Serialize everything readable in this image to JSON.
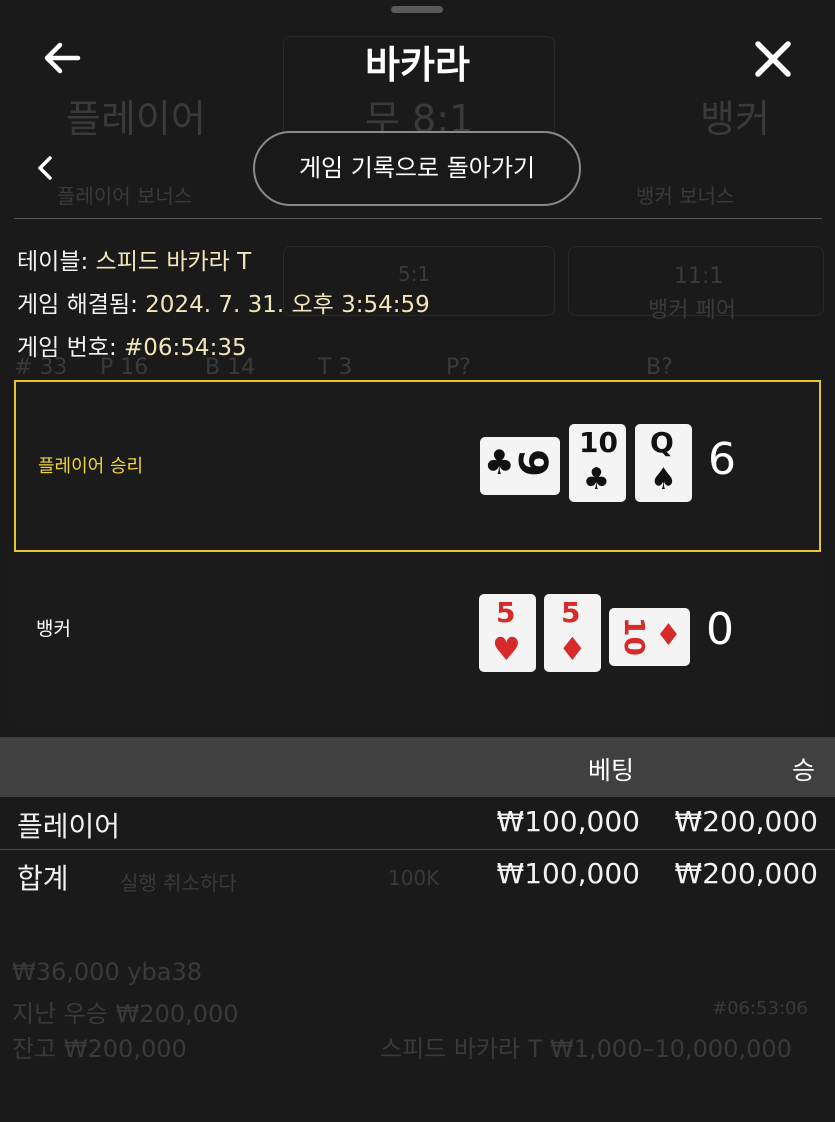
{
  "header": {
    "title": "바카라",
    "back_icon": "arrow-left-icon",
    "close_icon": "close-icon"
  },
  "nav": {
    "back_icon": "chevron-left-icon",
    "history_button": "게임 기록으로 돌아가기"
  },
  "info": {
    "table_label": "테이블: ",
    "table_value": "스피드 바카라 T",
    "resolved_label": "게임 해결됨: ",
    "resolved_value": "2024. 7. 31. 오후 3:54:59",
    "number_label": "게임 번호: ",
    "number_value": "#06:54:35"
  },
  "results": {
    "player": {
      "label": "플레이어 승리",
      "score": "6",
      "cards": [
        {
          "rank": "9",
          "suit": "♣",
          "color": "black",
          "rotated": true
        },
        {
          "rank": "10",
          "suit": "♣",
          "color": "black",
          "rotated": false
        },
        {
          "rank": "Q",
          "suit": "♠",
          "color": "black",
          "rotated": false
        }
      ]
    },
    "banker": {
      "label": "뱅커",
      "score": "0",
      "cards": [
        {
          "rank": "5",
          "suit": "♥",
          "color": "red",
          "rotated": false
        },
        {
          "rank": "5",
          "suit": "♦",
          "color": "red",
          "rotated": false
        },
        {
          "rank": "10",
          "suit": "♦",
          "color": "red",
          "rotated": true
        }
      ]
    }
  },
  "bet_table": {
    "columns": [
      "베팅",
      "승"
    ],
    "rows": [
      {
        "name": "플레이어",
        "bet": "₩100,000",
        "win": "₩200,000"
      }
    ],
    "total": {
      "name": "합계",
      "bet": "₩100,000",
      "win": "₩200,000"
    }
  },
  "background": {
    "labels": [
      "플레이어",
      "무 8:1",
      "뱅커",
      "플레이어 보너스",
      "뱅커 보너스",
      "5:1",
      "11:1",
      "뱅커 페어"
    ],
    "stats": [
      "# 33",
      "P 16",
      "B 14",
      "T 3",
      "P?",
      "B?"
    ],
    "chip": "100K",
    "undo": "실행 취소하다",
    "balance_rows": [
      "₩36,000 yba38",
      "지난 우승 ₩200,000",
      "잔고 ₩200,000"
    ],
    "table_limits": "스피드 바카라 T ₩1,000–10,000,000",
    "round_id": "#06:53:06"
  },
  "colors": {
    "win_border": "#e6c532",
    "win_text": "#f2d438",
    "red_suit": "#d72a2a",
    "table_header_bg": "#404040"
  }
}
